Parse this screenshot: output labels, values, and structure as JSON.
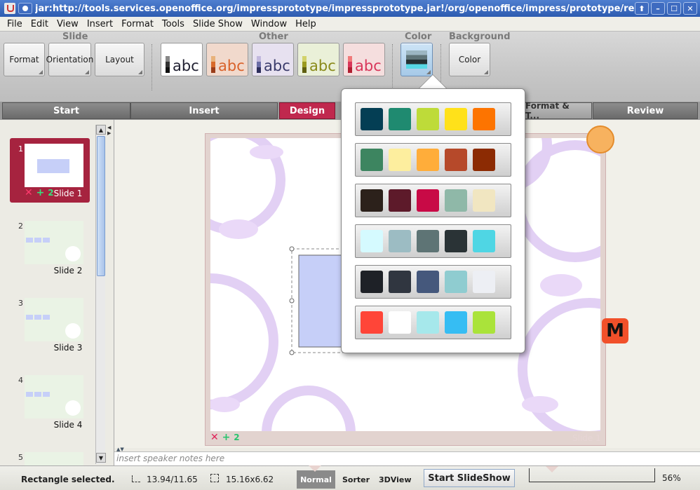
{
  "window": {
    "title": "jar:http://tools.services.openoffice.org/impressprototype/impressprototype.jar!/org/openoffice/impress/prototype/resource",
    "controls": [
      "⬆",
      "–",
      "☐",
      "✕"
    ]
  },
  "menu": [
    "File",
    "Edit",
    "View",
    "Insert",
    "Format",
    "Tools",
    "Slide Show",
    "Window",
    "Help"
  ],
  "ribbon": {
    "groups": {
      "slide": "Slide",
      "other": "Other",
      "color": "Color",
      "background": "Background"
    },
    "buttons": {
      "format": "Format",
      "orientation": "Orientation",
      "layout": "Layout",
      "bg_color": "Color"
    },
    "themes": [
      {
        "text": "abc",
        "bg": "#ffffff",
        "text_color": "#222233",
        "swatches": [
          "#888888",
          "#333333",
          "#111111"
        ]
      },
      {
        "text": "abc",
        "bg": "#f1d9cc",
        "text_color": "#d9622b",
        "swatches": [
          "#e8b27a",
          "#d86a2b",
          "#9a3d1a"
        ]
      },
      {
        "text": "abc",
        "bg": "#e7e1f0",
        "text_color": "#3a3b6b",
        "swatches": [
          "#c1b8dd",
          "#6b6da6",
          "#2d2e5c"
        ]
      },
      {
        "text": "abc",
        "bg": "#eaf0d8",
        "text_color": "#8a8a1a",
        "swatches": [
          "#d2d26a",
          "#9a9a1f",
          "#5f5f10"
        ]
      },
      {
        "text": "abc",
        "bg": "#f5dede",
        "text_color": "#d8365a",
        "swatches": [
          "#f07a7a",
          "#d8365a",
          "#b01e30"
        ]
      }
    ]
  },
  "tabs": {
    "start": "Start",
    "insert": "Insert",
    "design": "Design",
    "format": "Format & T...",
    "review": "Review"
  },
  "slides": [
    {
      "num": "1",
      "label": "Slide 1",
      "selected": true
    },
    {
      "num": "2",
      "label": "Slide 2",
      "selected": false
    },
    {
      "num": "3",
      "label": "Slide 3",
      "selected": false
    },
    {
      "num": "4",
      "label": "Slide 4",
      "selected": false
    },
    {
      "num": "5",
      "label": "",
      "selected": false
    }
  ],
  "slide_actions": {
    "delete": "✕",
    "add": "+",
    "count": "2"
  },
  "canvas": {
    "slide_name": "Slide 1",
    "badge": "M",
    "actions_count": "2"
  },
  "speaker_notes": {
    "placeholder": "insert speaker notes here"
  },
  "palette": [
    [
      "#043e54",
      "#1f8a70",
      "#bedb39",
      "#ffe11a",
      "#fd7400"
    ],
    [
      "#3d8560",
      "#fdee9e",
      "#ffad3a",
      "#b6492a",
      "#8c2b03"
    ],
    [
      "#2c211b",
      "#5d1a2a",
      "#c80a46",
      "#8fb8a8",
      "#f1e6c1"
    ],
    [
      "#d5faff",
      "#9cbcc3",
      "#5e7475",
      "#2a3336",
      "#4fd6e4"
    ],
    [
      "#1e2127",
      "#303640",
      "#45587c",
      "#8fccd0",
      "#edeff4"
    ],
    [
      "#ff4538",
      "#ffffff",
      "#a6e8eb",
      "#36bdf3",
      "#aae33a"
    ]
  ],
  "status": {
    "message": "Rectangle selected.",
    "position": "13.94/11.65",
    "size": "15.16x6.62",
    "views": {
      "normal": "Normal",
      "sorter": "Sorter",
      "view3d": "3DView"
    },
    "start_show": "Start SlideShow",
    "zoom": "56%"
  }
}
